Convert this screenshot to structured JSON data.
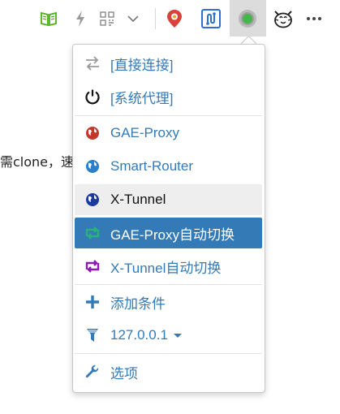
{
  "toolbar": {
    "icons": [
      "reading-list-icon",
      "flash-icon",
      "qr-code-icon",
      "chevron-down-icon",
      "location-pin-icon",
      "switch-proxy-icon",
      "xx-net-status-icon",
      "cat-face-icon",
      "more-icon"
    ],
    "status_color": "#43b84a"
  },
  "page": {
    "partial_text": "需clone，速度"
  },
  "menu": {
    "direct": "[直接连接]",
    "system": "[系统代理]",
    "gae_proxy": "GAE-Proxy",
    "smart_router": "Smart-Router",
    "x_tunnel": "X-Tunnel",
    "gae_auto": "GAE-Proxy自动切换",
    "xtunnel_auto": "X-Tunnel自动切换",
    "add_condition": "添加条件",
    "proxy_host": "127.0.0.1",
    "options": "选项"
  },
  "colors": {
    "accent": "#337ab7",
    "active_bg": "#337ab7",
    "hover_bg": "#eeeeee",
    "auto_green": "#2ab27b",
    "auto_purple": "#8e1bb0"
  }
}
